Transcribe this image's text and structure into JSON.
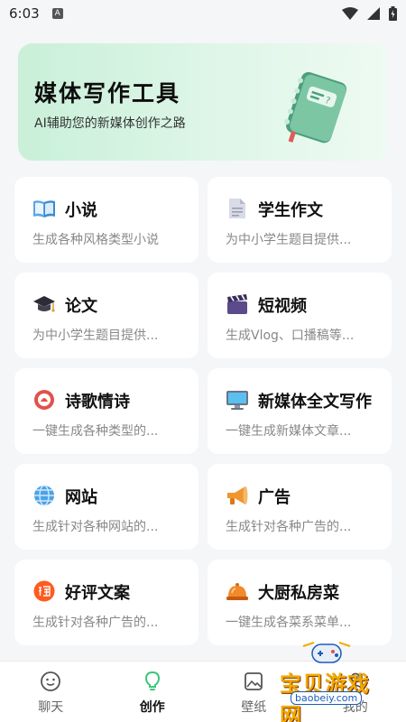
{
  "status_bar": {
    "time": "6:03",
    "notification_badge": "A"
  },
  "banner": {
    "title": "媒体写作工具",
    "subtitle": "AI辅助您的新媒体创作之路",
    "icon": "book-icon"
  },
  "cards": [
    {
      "title": "小说",
      "desc": "生成各种风格类型小说",
      "icon": "open-book-icon"
    },
    {
      "title": "学生作文",
      "desc": "为中小学生题目提供...",
      "icon": "document-icon"
    },
    {
      "title": "论文",
      "desc": "为中小学生题目提供...",
      "icon": "graduation-cap-icon"
    },
    {
      "title": "短视频",
      "desc": "生成Vlog、口播稿等...",
      "icon": "clapperboard-icon"
    },
    {
      "title": "诗歌情诗",
      "desc": "一键生成各种类型的...",
      "icon": "poem-icon"
    },
    {
      "title": "新媒体全文写作",
      "desc": "一键生成新媒体文章...",
      "icon": "monitor-icon"
    },
    {
      "title": "网站",
      "desc": "生成针对各种网站的...",
      "icon": "globe-icon"
    },
    {
      "title": "广告",
      "desc": "生成针对各种广告的...",
      "icon": "megaphone-icon"
    },
    {
      "title": "好评文案",
      "desc": "生成针对各种广告的...",
      "icon": "taobao-icon"
    },
    {
      "title": "大厨私房菜",
      "desc": "一键生成各菜系菜单...",
      "icon": "service-bell-icon"
    }
  ],
  "tabbar": {
    "tabs": [
      {
        "label": "聊天",
        "icon": "chat-icon"
      },
      {
        "label": "创作",
        "icon": "lightbulb-icon",
        "active": true
      },
      {
        "label": "壁纸",
        "icon": "wallpaper-icon"
      },
      {
        "label": "我的",
        "icon": "profile-icon"
      }
    ]
  },
  "watermark": {
    "text": "宝贝游戏网",
    "url": "baobeiy.com"
  },
  "colors": {
    "accent": "#3cc47c",
    "banner_bg": "#d6f3e2"
  }
}
